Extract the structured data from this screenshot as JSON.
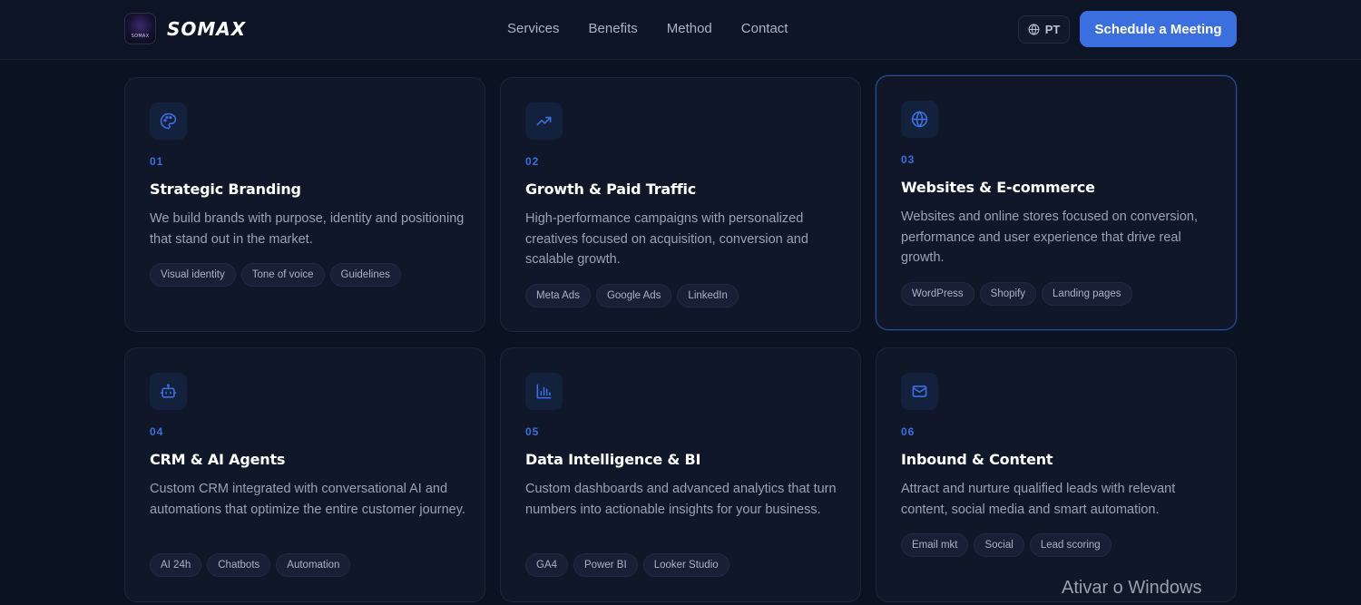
{
  "header": {
    "brand": "SOMAX",
    "logo_small_text": "SOMAX",
    "nav": [
      "Services",
      "Benefits",
      "Method",
      "Contact"
    ],
    "lang": "PT",
    "cta": "Schedule a Meeting"
  },
  "cards": [
    {
      "num": "01",
      "icon": "palette-icon",
      "title": "Strategic Branding",
      "desc": "We build brands with purpose, identity and positioning that stand out in the market.",
      "tags": [
        "Visual identity",
        "Tone of voice",
        "Guidelines"
      ]
    },
    {
      "num": "02",
      "icon": "trending-up-icon",
      "title": "Growth & Paid Traffic",
      "desc": "High-performance campaigns with personalized creatives focused on acquisition, conversion and scalable growth.",
      "tags": [
        "Meta Ads",
        "Google Ads",
        "LinkedIn"
      ]
    },
    {
      "num": "03",
      "icon": "globe-icon",
      "title": "Websites & E-commerce",
      "desc": "Websites and online stores focused on conversion, performance and user experience that drive real growth.",
      "tags": [
        "WordPress",
        "Shopify",
        "Landing pages"
      ]
    },
    {
      "num": "04",
      "icon": "bot-icon",
      "title": "CRM & AI Agents",
      "desc": "Custom CRM integrated with conversational AI and automations that optimize the entire customer journey.",
      "tags": [
        "AI 24h",
        "Chatbots",
        "Automation"
      ]
    },
    {
      "num": "05",
      "icon": "bar-chart-icon",
      "title": "Data Intelligence & BI",
      "desc": "Custom dashboards and advanced analytics that turn numbers into actionable insights for your business.",
      "tags": [
        "GA4",
        "Power BI",
        "Looker Studio"
      ]
    },
    {
      "num": "06",
      "icon": "mail-icon",
      "title": "Inbound & Content",
      "desc": "Attract and nurture qualified leads with relevant content, social media and smart automation.",
      "tags": [
        "Email mkt",
        "Social",
        "Lead scoring"
      ]
    }
  ],
  "watermark": "Ativar o Windows",
  "colors": {
    "accent": "#3b6fe0",
    "background": "#0b1222",
    "card": "#0f1729"
  }
}
